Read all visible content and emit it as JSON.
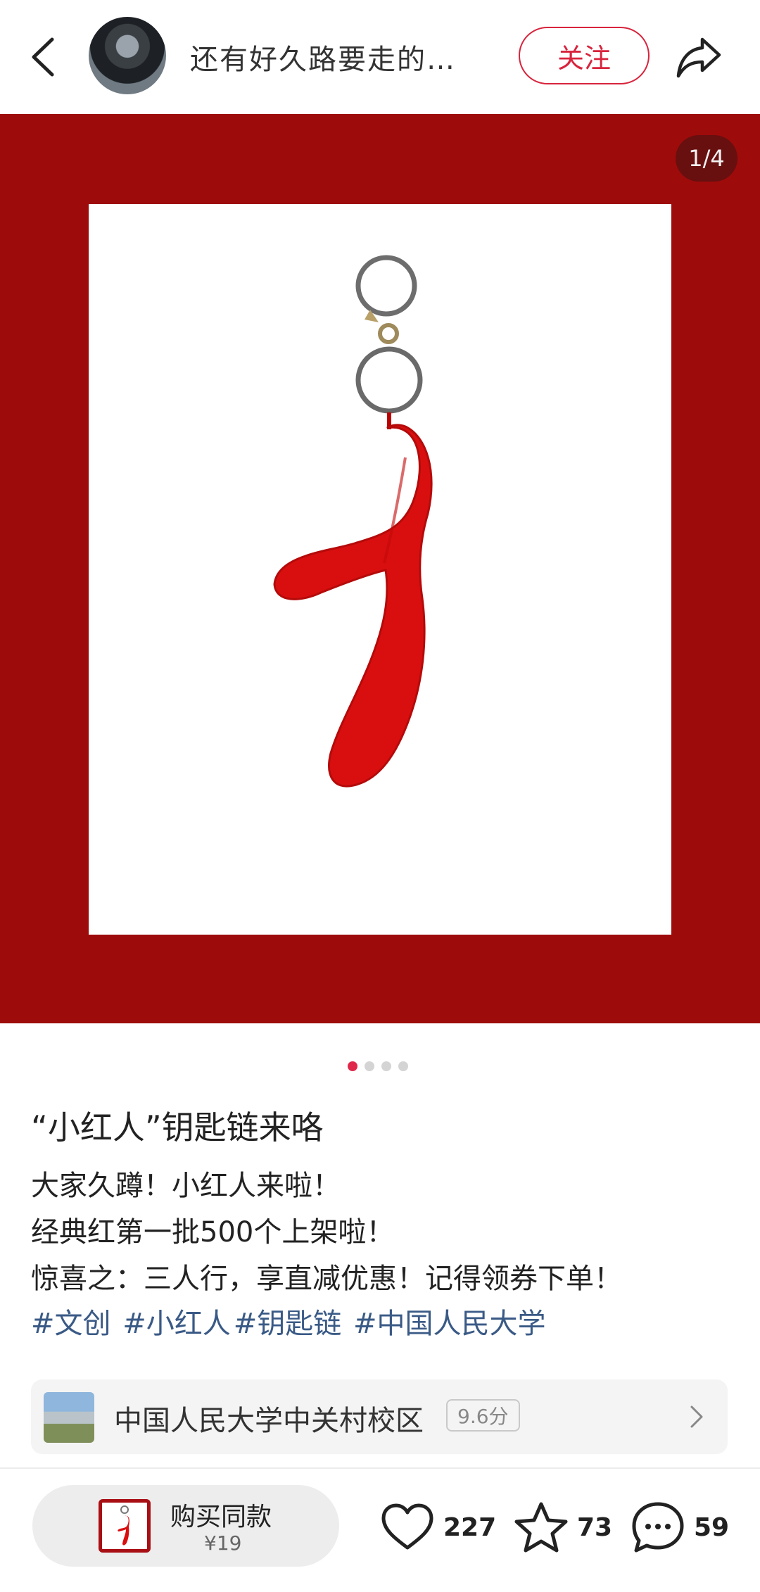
{
  "header": {
    "username": "还有好久路要走的…",
    "follow_label": "关注"
  },
  "media": {
    "page_counter": "1/4",
    "total_pages": 4,
    "current_page": 1,
    "background_color": "#9e0b0b"
  },
  "post": {
    "title": "“小红人”钥匙链来咯",
    "body_lines": [
      "大家久蹲！小红人来啦！",
      "经典红第一批500个上架啦！",
      "惊喜之：三人行，享直减优惠！记得领券下单！"
    ],
    "tags": [
      "#文创",
      "#小红人",
      "#钥匙链",
      "#中国人民大学"
    ]
  },
  "location": {
    "name": "中国人民大学中关村校区",
    "score": "9.6分"
  },
  "bottom_bar": {
    "buy_label": "购买同款",
    "buy_price": "¥19",
    "likes": "227",
    "favorites": "73",
    "comments": "59"
  },
  "colors": {
    "accent": "#d8243d",
    "tag": "#3a5a86",
    "media_bg": "#9e0b0b"
  },
  "icons": [
    "back-icon",
    "share-icon",
    "heart-icon",
    "star-icon",
    "comment-icon",
    "chevron-right-icon"
  ]
}
